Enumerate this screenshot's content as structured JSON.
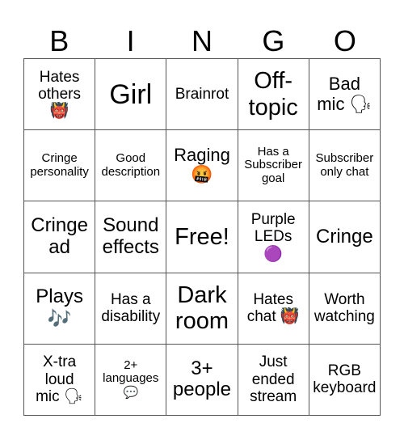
{
  "header": [
    "B",
    "I",
    "N",
    "G",
    "O"
  ],
  "rows": [
    [
      {
        "lines": [
          "Hates",
          "others"
        ],
        "emoji": "👹",
        "size": "s19"
      },
      {
        "lines": [
          "Girl"
        ],
        "size": "s34"
      },
      {
        "lines": [
          "Brainrot"
        ],
        "size": "s19"
      },
      {
        "lines": [
          "Off-",
          "topic"
        ],
        "size": "s29"
      },
      {
        "lines": [
          "Bad",
          "mic 🗣"
        ],
        "size": "s22"
      }
    ],
    [
      {
        "lines": [
          "Cringe",
          "personality"
        ],
        "size": "s15"
      },
      {
        "lines": [
          "Good",
          "description"
        ],
        "size": "s15"
      },
      {
        "lines": [
          "Raging"
        ],
        "emoji": "🤬",
        "size": "s22"
      },
      {
        "lines": [
          "Has a",
          "Subscriber",
          "goal"
        ],
        "size": "s15"
      },
      {
        "lines": [
          "Subscriber",
          "only chat"
        ],
        "size": "s15"
      }
    ],
    [
      {
        "lines": [
          "Cringe",
          "ad"
        ],
        "size": "s24"
      },
      {
        "lines": [
          "Sound",
          "effects"
        ],
        "size": "s24"
      },
      {
        "lines": [
          "Free!"
        ],
        "size": "s29"
      },
      {
        "lines": [
          "Purple",
          "LEDs"
        ],
        "emoji": "🟣",
        "size": "s19"
      },
      {
        "lines": [
          "Cringe"
        ],
        "size": "s24"
      }
    ],
    [
      {
        "lines": [
          "Plays"
        ],
        "emoji": "🎶",
        "size": "s24"
      },
      {
        "lines": [
          "Has a",
          "disability"
        ],
        "size": "s19"
      },
      {
        "lines": [
          "Dark",
          "room"
        ],
        "size": "s29"
      },
      {
        "lines": [
          "Hates",
          "chat 👹"
        ],
        "size": "s19"
      },
      {
        "lines": [
          "Worth",
          "watching"
        ],
        "size": "s19"
      }
    ],
    [
      {
        "lines": [
          "X-tra",
          "loud",
          "mic 🗣"
        ],
        "size": "s19"
      },
      {
        "lines": [
          "2+",
          "languages"
        ],
        "emoji": "💬",
        "size": "s15"
      },
      {
        "lines": [
          "3+",
          "people"
        ],
        "size": "s24"
      },
      {
        "lines": [
          "Just",
          "ended",
          "stream"
        ],
        "size": "s19"
      },
      {
        "lines": [
          "RGB",
          "keyboard"
        ],
        "size": "s19"
      }
    ]
  ]
}
